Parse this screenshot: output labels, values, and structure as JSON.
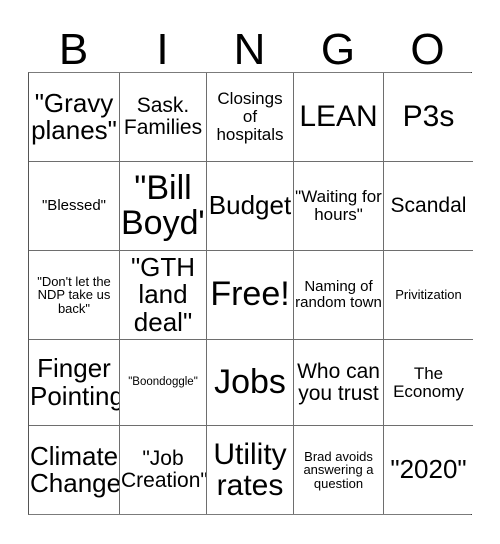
{
  "header": {
    "letters": [
      "B",
      "I",
      "N",
      "G",
      "O"
    ]
  },
  "grid": {
    "rows": 5,
    "columns": 5,
    "cells": [
      {
        "text": "\"Gravy planes\"",
        "size": "lg"
      },
      {
        "text": "Sask. Families",
        "size": "md"
      },
      {
        "text": "Closings of hospitals",
        "size": "sm"
      },
      {
        "text": "LEAN",
        "size": "xl"
      },
      {
        "text": "P3s",
        "size": "xl"
      },
      {
        "text": "\"Blessed\"",
        "size": "xs"
      },
      {
        "text": "\"Bill Boyd\"",
        "size": "xxl"
      },
      {
        "text": "Budget",
        "size": "lg"
      },
      {
        "text": "\"Waiting for hours\"",
        "size": "sm"
      },
      {
        "text": "Scandal",
        "size": "md"
      },
      {
        "text": "\"Don't let the NDP take us back\"",
        "size": "xxs"
      },
      {
        "text": "\"GTH land deal\"",
        "size": "lg"
      },
      {
        "text": "Free!",
        "size": "xxl"
      },
      {
        "text": "Naming of random town",
        "size": "xs"
      },
      {
        "text": "Privitization",
        "size": "xxs"
      },
      {
        "text": "Finger Pointing",
        "size": "lg"
      },
      {
        "text": "\"Boondoggle\"",
        "size": "tiny"
      },
      {
        "text": "Jobs",
        "size": "xxl"
      },
      {
        "text": "Who can you trust",
        "size": "md"
      },
      {
        "text": "The Economy",
        "size": "sm"
      },
      {
        "text": "Climate Change",
        "size": "lg"
      },
      {
        "text": "\"Job Creation\"",
        "size": "md"
      },
      {
        "text": "Utility rates",
        "size": "xl"
      },
      {
        "text": "Brad avoids answering a question",
        "size": "xxs"
      },
      {
        "text": "\"2020\"",
        "size": "lg"
      }
    ]
  }
}
